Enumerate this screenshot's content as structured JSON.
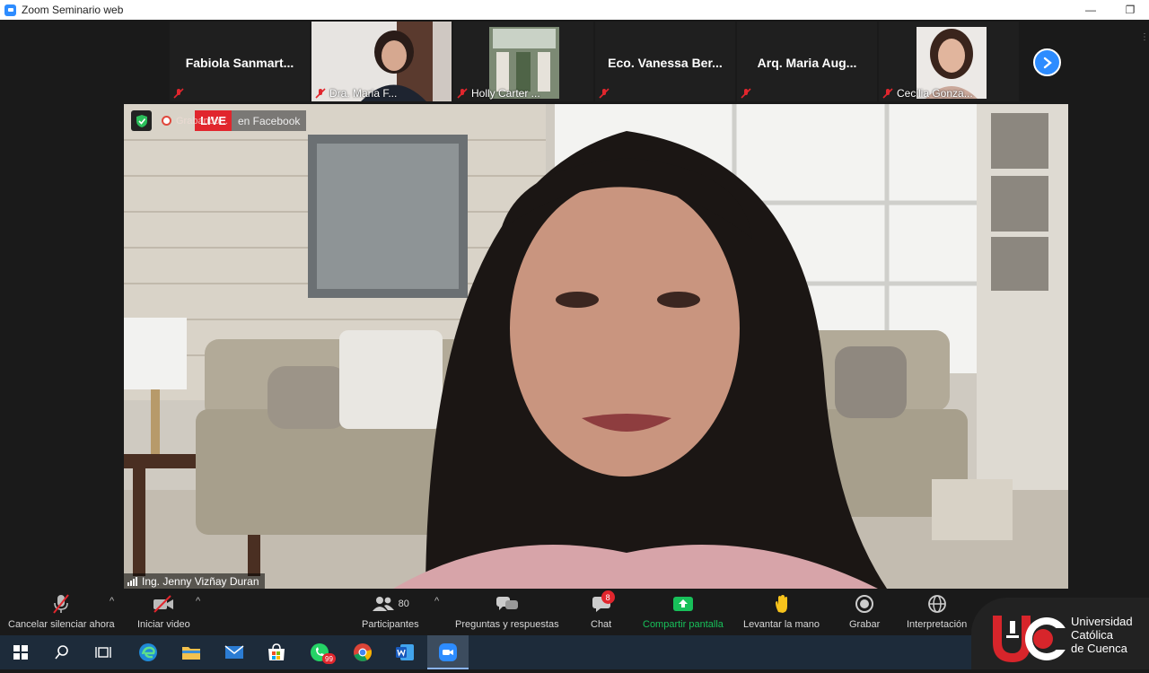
{
  "window": {
    "title": "Zoom Seminario web",
    "minimize_glyph": "—",
    "restore_glyph": "❐"
  },
  "gallery": {
    "thumbnails": [
      {
        "name": "Fabiola  Sanmart...",
        "label": "",
        "has_video": false,
        "muted": true
      },
      {
        "name": "",
        "label": "Dra. Maria F...",
        "has_video": true,
        "muted": true
      },
      {
        "name": "",
        "label": "Holly Carter ...",
        "has_video": true,
        "muted": true
      },
      {
        "name": "Eco. Vanessa Ber...",
        "label": "",
        "has_video": false,
        "muted": true
      },
      {
        "name": "Arq. Maria Aug...",
        "label": "",
        "has_video": false,
        "muted": true
      },
      {
        "name": "",
        "label": "Cecilia Gonza...",
        "has_video": true,
        "muted": true
      }
    ],
    "next_icon": "chevron-right-icon"
  },
  "main_video": {
    "security_icon": "shield-check-icon",
    "recording_text": "Grabando...",
    "live_label": "LIVE",
    "live_destination": "en Facebook",
    "speaker_name": "Ing. Jenny Vizñay Duran"
  },
  "toolbar": {
    "mute_label": "Cancelar silenciar ahora",
    "video_label": "Iniciar video",
    "participants_label": "Participantes",
    "participants_count": "80",
    "qa_label": "Preguntas y respuestas",
    "chat_label": "Chat",
    "chat_badge": "8",
    "share_label": "Compartir pantalla",
    "raise_hand_label": "Levantar la mano",
    "record_label": "Grabar",
    "interpretation_label": "Interpretación",
    "caret": "^"
  },
  "taskbar": {
    "items": [
      "windows-start",
      "search",
      "task-view",
      "edge",
      "file-explorer",
      "mail",
      "store",
      "whatsapp",
      "chrome",
      "word",
      "zoom"
    ],
    "whatsapp_badge": "99"
  },
  "logo": {
    "line1": "Universidad",
    "line2": "Católica",
    "line3": "de Cuenca"
  },
  "colors": {
    "accent": "#2d8cff",
    "live_red": "#e1262d",
    "share_green": "#18c05a",
    "logo_red": "#d7252b"
  }
}
